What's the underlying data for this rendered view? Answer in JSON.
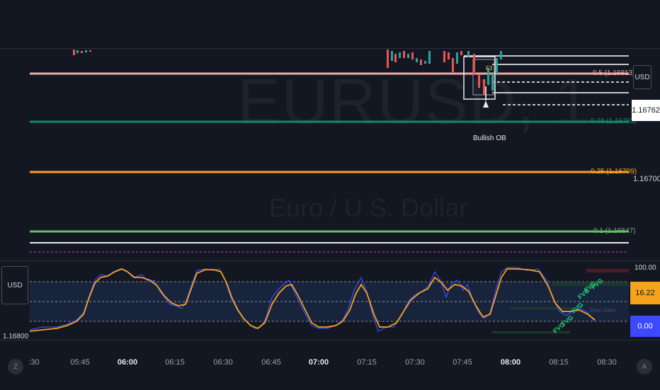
{
  "watermark": {
    "symbol": "EURUSD, 1",
    "description": "Euro / U.S. Dollar"
  },
  "colors": {
    "background": "#131722",
    "fib_05": "#f4a8a8",
    "fib_038": "#0f8a6a",
    "fib_025": "#f7a21b",
    "fib_01": "#66bb6a",
    "oscillator_main": "#f7a21b",
    "oscillator_signal": "#3d49ff",
    "fvg_text": "#1fd26f",
    "purple_dashed": "#9c27b0"
  },
  "fib_levels": [
    {
      "label": "0.5 (1.16813)",
      "color": "#f4a8a8"
    },
    {
      "label": "0.38 (1.16763)",
      "color": "#0f8a6a"
    },
    {
      "label": "0.25 (1.16709)",
      "color": "#f7a21b"
    },
    {
      "label": "0.1 (1.16647)",
      "color": "#66bb6a"
    }
  ],
  "price_axis": {
    "currency_button": "USD",
    "current_price": "1.16762",
    "level_label": "1.16700"
  },
  "ob_label": "Bullish OB",
  "ob_marker": "F3",
  "oscillator": {
    "currency_button": "USD",
    "price_stub": "1.16800",
    "top_label": "100.00",
    "value_orange": "16.22",
    "value_blue": "0.00",
    "faint_label": "Zhen Sam",
    "fvg_tags": [
      "FVG",
      "FVG",
      "FVG",
      "FVG",
      "FVG",
      "FVG"
    ]
  },
  "time_axis": {
    "ticks": [
      {
        "label": ":30",
        "bold": false
      },
      {
        "label": "05:45",
        "bold": false
      },
      {
        "label": "06:00",
        "bold": true
      },
      {
        "label": "06:15",
        "bold": false
      },
      {
        "label": "06:30",
        "bold": false
      },
      {
        "label": "06:45",
        "bold": false
      },
      {
        "label": "07:00",
        "bold": true
      },
      {
        "label": "07:15",
        "bold": false
      },
      {
        "label": "07:30",
        "bold": false
      },
      {
        "label": "07:45",
        "bold": false
      },
      {
        "label": "08:00",
        "bold": true
      },
      {
        "label": "08:15",
        "bold": false
      },
      {
        "label": "08:30",
        "bold": false
      }
    ],
    "left_button": "Z",
    "right_button": "A"
  }
}
